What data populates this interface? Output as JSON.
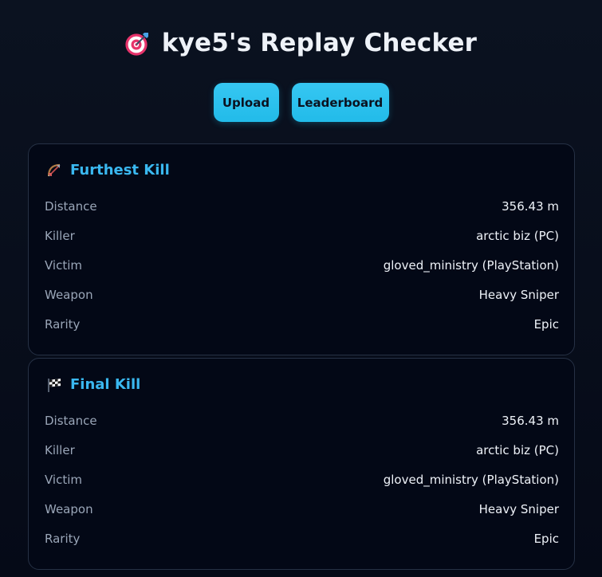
{
  "header": {
    "title": "kye5's Replay Checker",
    "icon": "target-dart-icon"
  },
  "nav": {
    "upload_label": "Upload",
    "leaderboard_label": "Leaderboard",
    "button_color": "#22bbe9"
  },
  "cards": [
    {
      "title": "Furthest Kill",
      "icon": "bow-arrow-icon",
      "rows": [
        {
          "label": "Distance",
          "value": "356.43 m"
        },
        {
          "label": "Killer",
          "value": "arctic biz (PC)"
        },
        {
          "label": "Victim",
          "value": "gloved_ministry (PlayStation)"
        },
        {
          "label": "Weapon",
          "value": "Heavy Sniper"
        },
        {
          "label": "Rarity",
          "value": "Epic"
        }
      ]
    },
    {
      "title": "Final Kill",
      "icon": "checkered-flag-icon",
      "rows": [
        {
          "label": "Distance",
          "value": "356.43 m"
        },
        {
          "label": "Killer",
          "value": "arctic biz (PC)"
        },
        {
          "label": "Victim",
          "value": "gloved_ministry (PlayStation)"
        },
        {
          "label": "Weapon",
          "value": "Heavy Sniper"
        },
        {
          "label": "Rarity",
          "value": "Epic"
        }
      ]
    }
  ],
  "colors": {
    "accent": "#3ab8f0",
    "background": "#050a17"
  }
}
